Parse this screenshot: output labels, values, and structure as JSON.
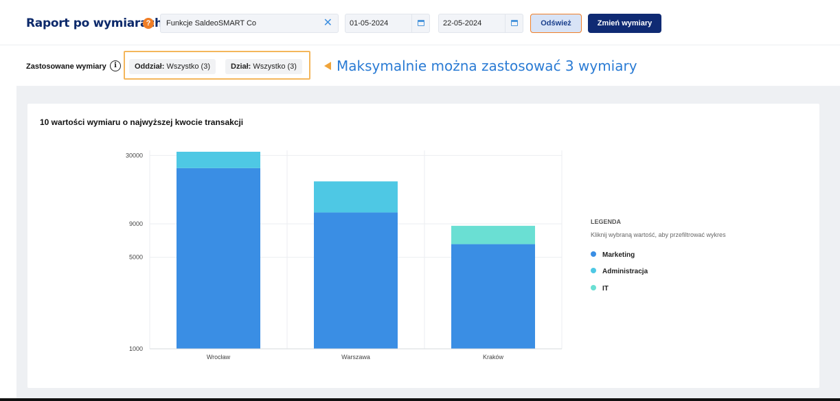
{
  "header": {
    "title": "Raport po wymiarach",
    "help_icon": "question-icon",
    "help_glyph": "?",
    "company_value": "Funkcje SaldeoSMART Co",
    "clear_glyph": "✕",
    "date_from": "01-05-2024",
    "date_to": "22-05-2024",
    "refresh_label": "Odśwież",
    "change_label": "Zmień wymiary"
  },
  "dimensions": {
    "label": "Zastosowane wymiary",
    "info_glyph": "i",
    "chips": [
      {
        "key": "Oddział:",
        "value": " Wszystko (3)"
      },
      {
        "key": "Dział:",
        "value": " Wszystko (3)"
      }
    ],
    "annotation": "Maksymalnie można zastosować 3 wymiary"
  },
  "card": {
    "title": "10 wartości wymiaru o najwyższej kwocie transakcji"
  },
  "legend": {
    "title": "LEGENDA",
    "hint": "Kliknij wybraną wartość, aby przefiltrować wykres",
    "items": [
      "Marketing",
      "Administracja",
      "IT"
    ]
  },
  "colors": {
    "Marketing": "#3a8ee4",
    "Administracja": "#4ec8e4",
    "IT": "#6adfd3",
    "brand": "#0f2a73",
    "accent": "#f07e26"
  },
  "chart_data": {
    "type": "bar",
    "stacked": true,
    "scale": "log",
    "categories": [
      "Wrocław",
      "Warszawa",
      "Kraków"
    ],
    "series": [
      {
        "name": "Marketing",
        "values": [
          24000,
          11000,
          6300
        ]
      },
      {
        "name": "Administracja",
        "values": [
          8000,
          8000,
          0
        ]
      },
      {
        "name": "IT",
        "values": [
          0,
          0,
          2400
        ]
      }
    ],
    "yticks": [
      1000,
      5000,
      9000,
      30000
    ],
    "ylim": [
      1000,
      32000
    ],
    "grid": true,
    "legend_position": "right"
  }
}
